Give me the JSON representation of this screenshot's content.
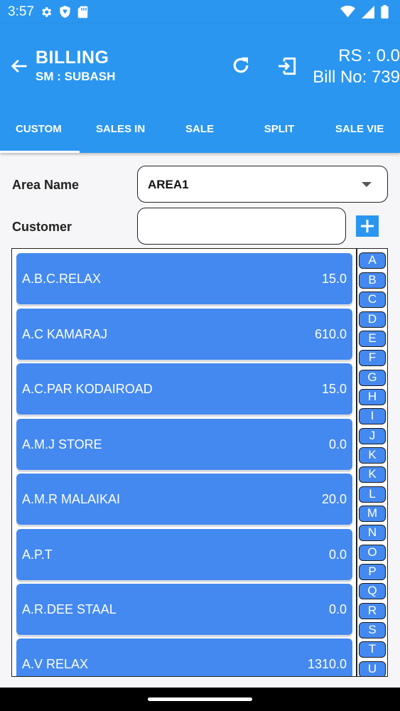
{
  "status_bar": {
    "time": "3:57"
  },
  "app_bar": {
    "title": "BILLING",
    "subtitle": "SM : SUBASH",
    "amount": "RS : 0.0",
    "bill_no": "Bill No: 739"
  },
  "tabs": [
    {
      "label": "CUSTOM"
    },
    {
      "label": "SALES IN"
    },
    {
      "label": "SALE"
    },
    {
      "label": "SPLIT"
    },
    {
      "label": "SALE VIE"
    }
  ],
  "form": {
    "area_label": "Area Name",
    "area_value": "AREA1",
    "customer_label": "Customer",
    "customer_value": "",
    "add_label": "+"
  },
  "customers": [
    {
      "name": "A.B.C.RELAX",
      "amount": "15.0"
    },
    {
      "name": "A.C KAMARAJ",
      "amount": "610.0"
    },
    {
      "name": "A.C.PAR KODAIROAD",
      "amount": "15.0"
    },
    {
      "name": "A.M.J STORE",
      "amount": "0.0"
    },
    {
      "name": "A.M.R MALAIKAI",
      "amount": "20.0"
    },
    {
      "name": "A.P.T",
      "amount": "0.0"
    },
    {
      "name": "A.R.DEE STAAL",
      "amount": "0.0"
    },
    {
      "name": "A.V RELAX",
      "amount": "1310.0"
    }
  ],
  "alphabet": [
    "A",
    "B",
    "C",
    "D",
    "E",
    "F",
    "G",
    "H",
    "I",
    "J",
    "K",
    "K",
    "L",
    "M",
    "N",
    "O",
    "P",
    "Q",
    "R",
    "S",
    "T",
    "U"
  ]
}
